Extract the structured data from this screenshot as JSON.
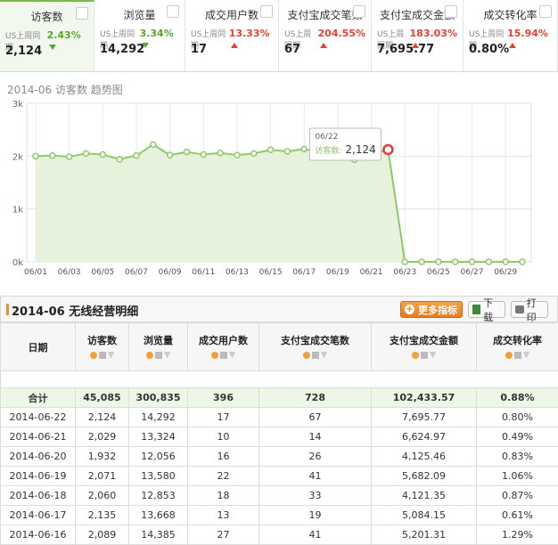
{
  "kpi_tabs": [
    {
      "name": "访客数",
      "compare_label": "US上周同期",
      "change": "2.43%",
      "direction": "down",
      "value": "2,124",
      "active": true
    },
    {
      "name": "浏览量",
      "compare_label": "US上周同期",
      "change": "3.34%",
      "direction": "down",
      "value": "14,292",
      "active": false
    },
    {
      "name": "成交用户数",
      "compare_label": "US上周同期",
      "change": "13.33%",
      "direction": "up",
      "value": "17",
      "active": false
    },
    {
      "name": "支付宝成交笔数",
      "compare_label": "US上周同期",
      "change": "204.55%",
      "direction": "up",
      "value": "67",
      "active": false
    },
    {
      "name": "支付宝成交金额",
      "compare_label": "US上周同期",
      "change": "183.03%",
      "direction": "up",
      "value": "7,695.77",
      "active": false
    },
    {
      "name": "成交转化率",
      "compare_label": "US上周同期",
      "change": "15.94%",
      "direction": "up",
      "value": "0.80%",
      "active": false
    }
  ],
  "chart_title": "2014-06 访客数 趋势图",
  "chart_data": {
    "type": "area",
    "title": "2014-06 访客数 趋势图",
    "x": [
      "06/01",
      "06/02",
      "06/03",
      "06/04",
      "06/05",
      "06/06",
      "06/07",
      "06/08",
      "06/09",
      "06/10",
      "06/11",
      "06/12",
      "06/13",
      "06/14",
      "06/15",
      "06/16",
      "06/17",
      "06/18",
      "06/19",
      "06/20",
      "06/21",
      "06/22",
      "06/23",
      "06/24",
      "06/25",
      "06/26",
      "06/27",
      "06/28",
      "06/29",
      "06/30"
    ],
    "x_tick_labels": [
      "06/01",
      "06/03",
      "06/05",
      "06/07",
      "06/09",
      "06/11",
      "06/13",
      "06/15",
      "06/17",
      "06/19",
      "06/21",
      "06/23",
      "06/25",
      "06/27",
      "06/29"
    ],
    "y_tick_labels": [
      "0k",
      "1k",
      "2k",
      "3k"
    ],
    "ylim": [
      0,
      3000
    ],
    "series": [
      {
        "values": [
          2000,
          2010,
          1990,
          2050,
          2030,
          1940,
          2010,
          2220,
          2020,
          2080,
          2030,
          2060,
          2020,
          2050,
          2120,
          2090,
          2135,
          2060,
          2071,
          1932,
          2029,
          2124,
          0,
          0,
          0,
          0,
          0,
          0,
          0,
          0
        ]
      }
    ],
    "tooltip": {
      "date": "06/22",
      "label": "访客数:",
      "value": "2,124"
    },
    "highlight_index": 21,
    "grid": true,
    "color": "#8fc96a",
    "fill_color": "#e6f2dc"
  },
  "detail": {
    "title": "2014-06 无线经营明细",
    "more_button": "更多指标",
    "download_button": "下载",
    "print_button": "打印"
  },
  "table": {
    "headers": [
      "日期",
      "访客数",
      "浏览量",
      "成交用户数",
      "支付宝成交笔数",
      "支付宝成交金额",
      "成交转化率"
    ],
    "total": [
      "合计",
      "45,085",
      "300,835",
      "396",
      "728",
      "102,433.57",
      "0.88%"
    ],
    "rows": [
      [
        "2014-06-22",
        "2,124",
        "14,292",
        "17",
        "67",
        "7,695.77",
        "0.80%"
      ],
      [
        "2014-06-21",
        "2,029",
        "13,324",
        "10",
        "14",
        "6,624.97",
        "0.49%"
      ],
      [
        "2014-06-20",
        "1,932",
        "12,056",
        "16",
        "26",
        "4,125.46",
        "0.83%"
      ],
      [
        "2014-06-19",
        "2,071",
        "13,580",
        "22",
        "41",
        "5,682.09",
        "1.06%"
      ],
      [
        "2014-06-18",
        "2,060",
        "12,853",
        "18",
        "33",
        "4,121.35",
        "0.87%"
      ],
      [
        "2014-06-17",
        "2,135",
        "13,668",
        "13",
        "19",
        "5,084.15",
        "0.61%"
      ],
      [
        "2014-06-16",
        "2,089",
        "14,385",
        "27",
        "41",
        "5,201.31",
        "1.29%"
      ]
    ]
  }
}
